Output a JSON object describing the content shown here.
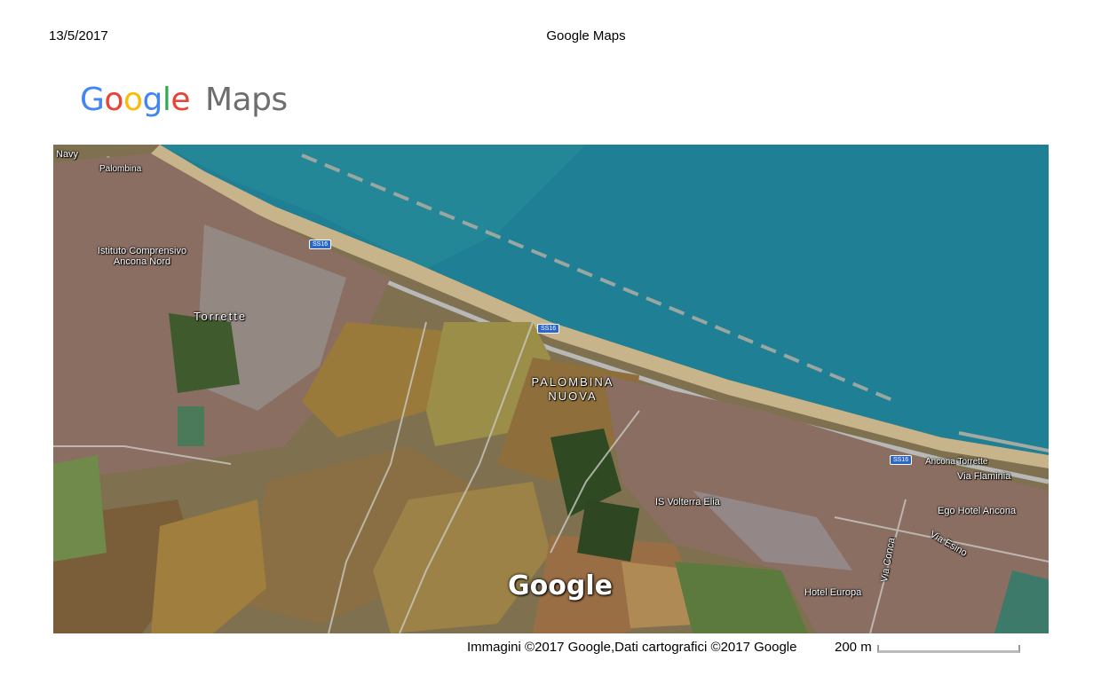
{
  "header": {
    "date": "13/5/2017",
    "title": "Google Maps"
  },
  "logo": {
    "letters": [
      {
        "char": "G",
        "color": "#4285F4"
      },
      {
        "char": "o",
        "color": "#EA4335"
      },
      {
        "char": "o",
        "color": "#FBBC05"
      },
      {
        "char": "g",
        "color": "#4285F4"
      },
      {
        "char": "l",
        "color": "#34A853"
      },
      {
        "char": "e",
        "color": "#EA4335"
      }
    ],
    "product": "Maps",
    "product_color": "#6e6e6e"
  },
  "map": {
    "view": "satellite",
    "labels": {
      "navy": "Navy",
      "palombina": "Palombina",
      "school": "Istituto Comprensivo Ancona Nord",
      "torrette": "Torrette",
      "palombina_nuova": "PALOMBINA NUOVA",
      "ss16_a": "SS16",
      "ss16_b": "SS16",
      "ss16_c": "SS16",
      "ancona_torrette": "Ancona Torrette",
      "via_flaminia": "Via Flaminia",
      "is_volterra": "IS Volterra Elia",
      "ego_hotel": "Ego Hotel Ancona",
      "via_esino": "Via Esino",
      "hotel_europa": "Hotel Europa",
      "via_conca": "Via Conca"
    },
    "watermark": "Google"
  },
  "footer": {
    "attribution": "Immagini ©2017 Google,Dati cartografici ©2017 Google",
    "scale_label": "200 m"
  },
  "colors": {
    "sea": "#1f7f94",
    "beach": "#c8b48a",
    "fields": "#9a7a3a",
    "urban": "#8a6e62"
  }
}
